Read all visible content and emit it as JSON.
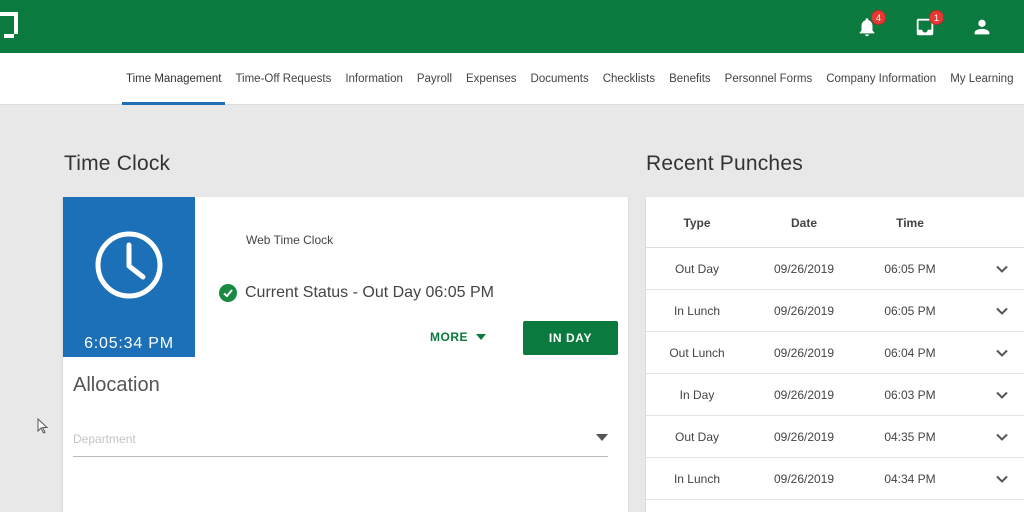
{
  "header": {
    "brand_color": "#0b7a3e",
    "notifications": {
      "icon": "bell-icon",
      "count": "4"
    },
    "inbox": {
      "icon": "inbox-icon",
      "count": "1"
    },
    "profile": {
      "icon": "user-icon"
    }
  },
  "nav": {
    "active_color": "#1f6fb5",
    "items": [
      {
        "label": "Time Management",
        "active": true
      },
      {
        "label": "Time-Off Requests"
      },
      {
        "label": "Information"
      },
      {
        "label": "Payroll"
      },
      {
        "label": "Expenses"
      },
      {
        "label": "Documents"
      },
      {
        "label": "Checklists"
      },
      {
        "label": "Benefits"
      },
      {
        "label": "Personnel Forms"
      },
      {
        "label": "Company Information"
      },
      {
        "label": "My Learning"
      }
    ]
  },
  "time_clock": {
    "title": "Time Clock",
    "current_time": "6:05:34 PM",
    "clock_label": "Web Time Clock",
    "status": "Current Status - Out Day 06:05 PM",
    "more_label": "MORE",
    "action_label": "IN DAY",
    "allocation_title": "Allocation",
    "department_placeholder": "Department"
  },
  "recent_punches": {
    "title": "Recent Punches",
    "columns": [
      "Type",
      "Date",
      "Time"
    ],
    "rows": [
      {
        "type": "Out Day",
        "date": "09/26/2019",
        "time": "06:05 PM"
      },
      {
        "type": "In Lunch",
        "date": "09/26/2019",
        "time": "06:05 PM"
      },
      {
        "type": "Out Lunch",
        "date": "09/26/2019",
        "time": "06:04 PM"
      },
      {
        "type": "In Day",
        "date": "09/26/2019",
        "time": "06:03 PM"
      },
      {
        "type": "Out Day",
        "date": "09/26/2019",
        "time": "04:35 PM"
      },
      {
        "type": "In Lunch",
        "date": "09/26/2019",
        "time": "04:34 PM"
      }
    ]
  }
}
